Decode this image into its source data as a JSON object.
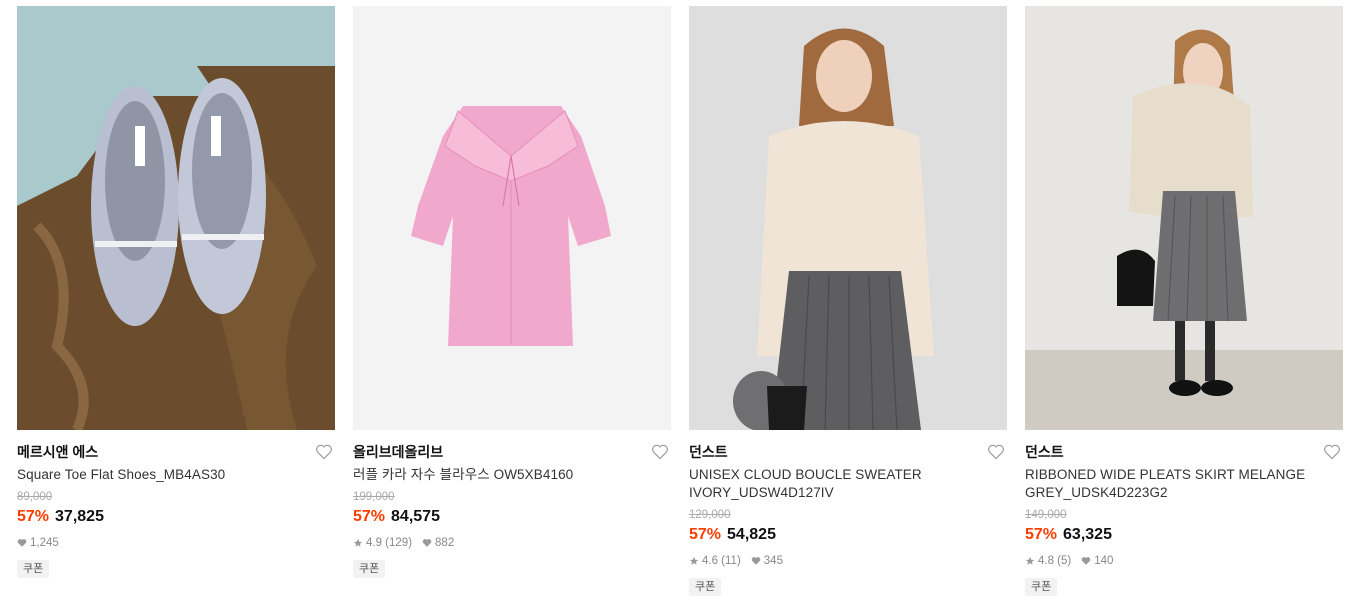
{
  "products": [
    {
      "brand": "메르시앤 에스",
      "name": "Square Toe Flat Shoes_MB4AS30",
      "original_price": "89,000",
      "discount": "57%",
      "price": "37,825",
      "likes": "1,245",
      "coupon": "쿠폰"
    },
    {
      "brand": "올리브데올리브",
      "name": "러플 카라 자수 블라우스 OW5XB4160",
      "original_price": "199,000",
      "discount": "57%",
      "price": "84,575",
      "rating": "4.9 (129)",
      "likes": "882",
      "coupon": "쿠폰"
    },
    {
      "brand": "던스트",
      "name": "UNISEX CLOUD BOUCLE SWEATER IVORY_UDSW4D127IV",
      "original_price": "129,000",
      "discount": "57%",
      "price": "54,825",
      "rating": "4.6 (11)",
      "likes": "345",
      "coupon": "쿠폰"
    },
    {
      "brand": "던스트",
      "name": "RIBBONED WIDE PLEATS SKIRT MELANGE GREY_UDSK4D223G2",
      "original_price": "149,000",
      "discount": "57%",
      "price": "63,325",
      "rating": "4.8 (5)",
      "likes": "140",
      "coupon": "쿠폰"
    }
  ],
  "colors": {
    "discount": "#ff3d00",
    "muted": "#888888"
  }
}
